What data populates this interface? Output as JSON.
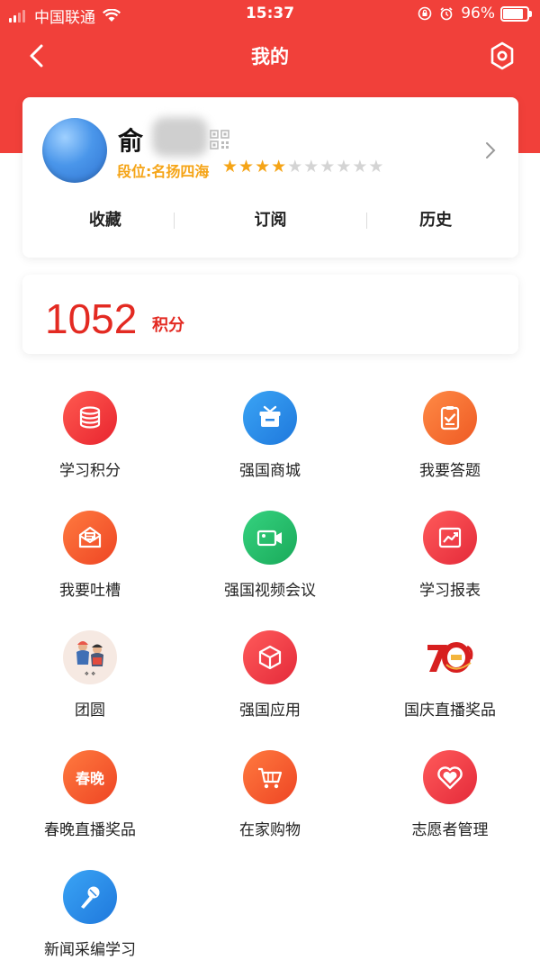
{
  "status_bar": {
    "carrier": "中国联通",
    "time": "15:37",
    "battery": "96%"
  },
  "nav": {
    "title": "我的"
  },
  "profile": {
    "name_visible": "俞",
    "rank_label": "段位:名扬四海",
    "stars_filled": 4,
    "stars_total": 10,
    "tabs": [
      {
        "label": "收藏"
      },
      {
        "label": "订阅"
      },
      {
        "label": "历史"
      }
    ]
  },
  "points": {
    "value": "1052",
    "unit": "积分"
  },
  "grid": [
    {
      "label": "学习积分",
      "icon": "database-icon",
      "color": "#f23b3f"
    },
    {
      "label": "强国商城",
      "icon": "gift-icon",
      "color": "#2b8de8"
    },
    {
      "label": "我要答题",
      "icon": "quiz-icon",
      "color": "#f36a31"
    },
    {
      "label": "我要吐槽",
      "icon": "feedback-mail-icon",
      "color": "#f3592f"
    },
    {
      "label": "强国视频会议",
      "icon": "video-camera-icon",
      "color": "#22c06b"
    },
    {
      "label": "学习报表",
      "icon": "report-chart-icon",
      "color": "#ef3a47"
    },
    {
      "label": "团圆",
      "icon": "reunion-illustration-icon",
      "color": "#f6e9e2"
    },
    {
      "label": "强国应用",
      "icon": "cube-icon",
      "color": "#ef3a47"
    },
    {
      "label": "国庆直播奖品",
      "icon": "national-day-70-icon",
      "color": "#ffffff"
    },
    {
      "label": "春晚直播奖品",
      "icon_text": "春晚",
      "icon": "spring-gala-icon",
      "color": "#f3592f"
    },
    {
      "label": "在家购物",
      "icon": "shopping-cart-icon",
      "color": "#f3592f"
    },
    {
      "label": "志愿者管理",
      "icon": "heart-icon",
      "color": "#ef3a47"
    },
    {
      "label": "新闻采编学习",
      "icon": "microphone-icon",
      "color": "#2b8de8"
    }
  ]
}
